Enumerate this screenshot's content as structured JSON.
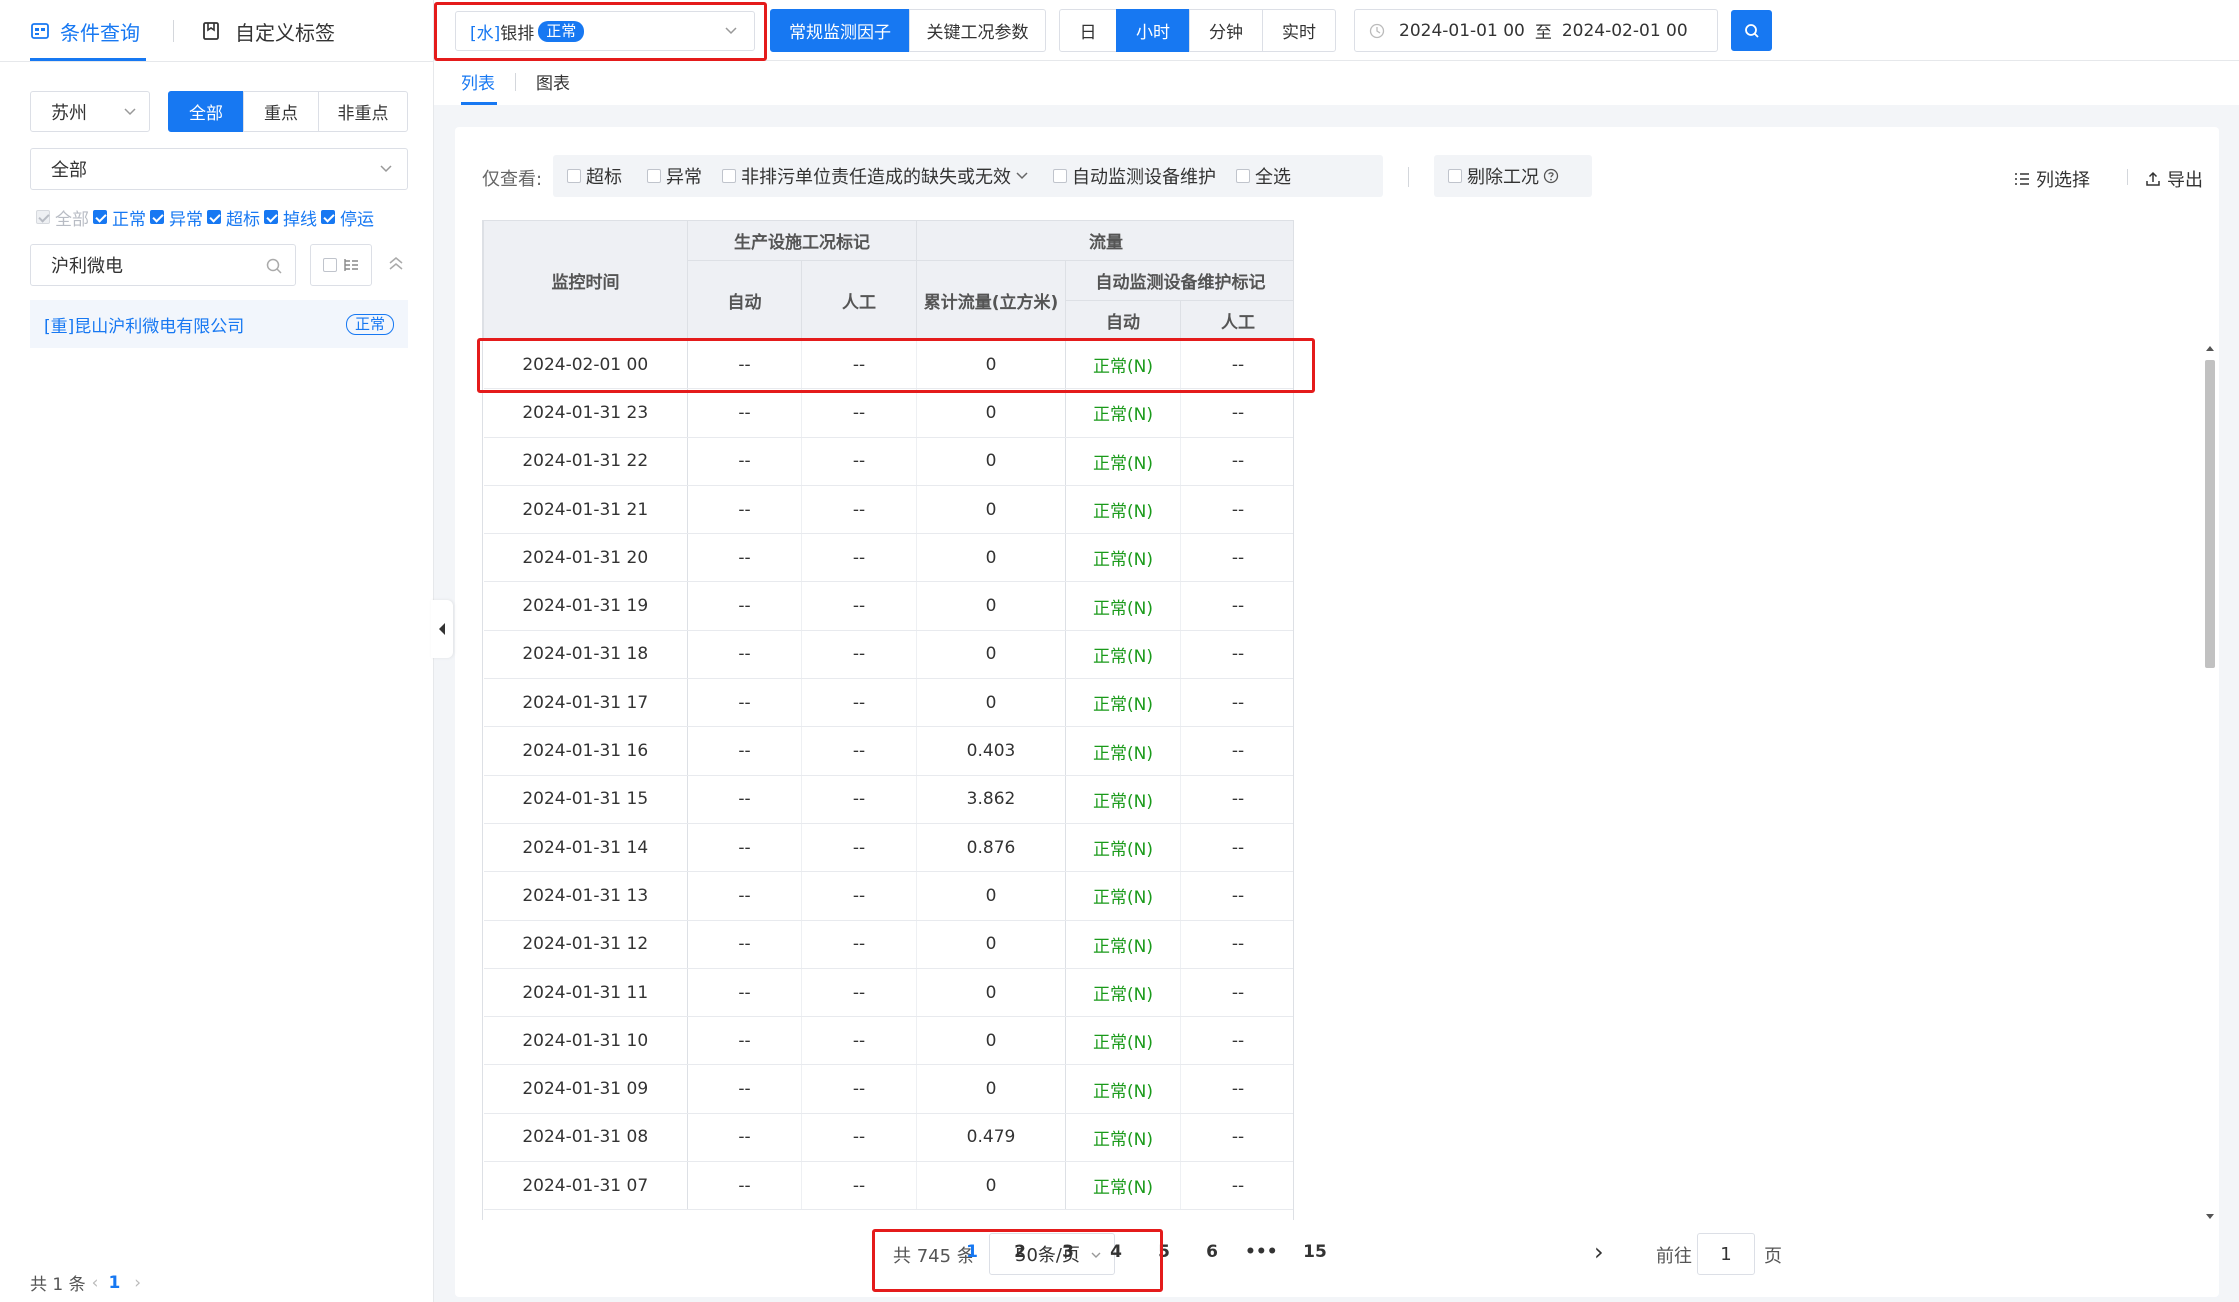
{
  "sidebar": {
    "tabs": [
      {
        "label": "条件查询",
        "active": true
      },
      {
        "label": "自定义标签",
        "active": false
      }
    ],
    "city": "苏州",
    "priority_buttons": [
      "全部",
      "重点",
      "非重点"
    ],
    "category": "全部",
    "status_filters": [
      {
        "label": "全部",
        "checked": true,
        "disabled": true
      },
      {
        "label": "正常",
        "checked": true
      },
      {
        "label": "异常",
        "checked": true
      },
      {
        "label": "超标",
        "checked": true
      },
      {
        "label": "掉线",
        "checked": true
      },
      {
        "label": "停运",
        "checked": true
      }
    ],
    "search_value": "沪利微电",
    "company": {
      "name": "[重]昆山沪利微电有限公司",
      "status": "正常"
    },
    "footer": {
      "total": "共 1 条",
      "page": "1"
    }
  },
  "topbar": {
    "selector": {
      "prefix": "[水]",
      "name": "银排",
      "status": "正常"
    },
    "factor_tabs": [
      "常规监测因子",
      "关键工况参数"
    ],
    "time_tabs": [
      "日",
      "小时",
      "分钟",
      "实时"
    ],
    "date_start": "2024-01-01 00",
    "date_sep": "至",
    "date_end": "2024-02-01 00"
  },
  "view_tabs": [
    "列表",
    "图表"
  ],
  "filters": {
    "label": "仅查看:",
    "options": [
      "超标",
      "异常",
      "非排污单位责任造成的缺失或无效",
      "自动监测设备维护",
      "全选"
    ],
    "exclude": "剔除工况",
    "column_select": "列选择",
    "export": "导出"
  },
  "table": {
    "headers": {
      "time": "监控时间",
      "group1": "生产设施工况标记",
      "auto": "自动",
      "manual": "人工",
      "flow": "流量",
      "cumulative": "累计流量(立方米)",
      "maint": "自动监测设备维护标记",
      "maint_auto": "自动",
      "maint_manual": "人工"
    },
    "rows": [
      [
        "2024-02-01 00",
        "--",
        "--",
        "0",
        "正常(N)",
        "--"
      ],
      [
        "2024-01-31 23",
        "--",
        "--",
        "0",
        "正常(N)",
        "--"
      ],
      [
        "2024-01-31 22",
        "--",
        "--",
        "0",
        "正常(N)",
        "--"
      ],
      [
        "2024-01-31 21",
        "--",
        "--",
        "0",
        "正常(N)",
        "--"
      ],
      [
        "2024-01-31 20",
        "--",
        "--",
        "0",
        "正常(N)",
        "--"
      ],
      [
        "2024-01-31 19",
        "--",
        "--",
        "0",
        "正常(N)",
        "--"
      ],
      [
        "2024-01-31 18",
        "--",
        "--",
        "0",
        "正常(N)",
        "--"
      ],
      [
        "2024-01-31 17",
        "--",
        "--",
        "0",
        "正常(N)",
        "--"
      ],
      [
        "2024-01-31 16",
        "--",
        "--",
        "0.403",
        "正常(N)",
        "--"
      ],
      [
        "2024-01-31 15",
        "--",
        "--",
        "3.862",
        "正常(N)",
        "--"
      ],
      [
        "2024-01-31 14",
        "--",
        "--",
        "0.876",
        "正常(N)",
        "--"
      ],
      [
        "2024-01-31 13",
        "--",
        "--",
        "0",
        "正常(N)",
        "--"
      ],
      [
        "2024-01-31 12",
        "--",
        "--",
        "0",
        "正常(N)",
        "--"
      ],
      [
        "2024-01-31 11",
        "--",
        "--",
        "0",
        "正常(N)",
        "--"
      ],
      [
        "2024-01-31 10",
        "--",
        "--",
        "0",
        "正常(N)",
        "--"
      ],
      [
        "2024-01-31 09",
        "--",
        "--",
        "0",
        "正常(N)",
        "--"
      ],
      [
        "2024-01-31 08",
        "--",
        "--",
        "0.479",
        "正常(N)",
        "--"
      ],
      [
        "2024-01-31 07",
        "--",
        "--",
        "0",
        "正常(N)",
        "--"
      ]
    ]
  },
  "pagination": {
    "total": "共 745 条",
    "page_size": "50条/页",
    "pages": [
      "1",
      "2",
      "3",
      "4",
      "5",
      "6",
      "•••",
      "15"
    ],
    "current": "1",
    "goto_label": "前往",
    "goto_value": "1",
    "goto_suffix": "页"
  },
  "colors": {
    "primary": "#1778f2",
    "ok": "#1a9a1a",
    "highlight": "#e41b1b"
  }
}
